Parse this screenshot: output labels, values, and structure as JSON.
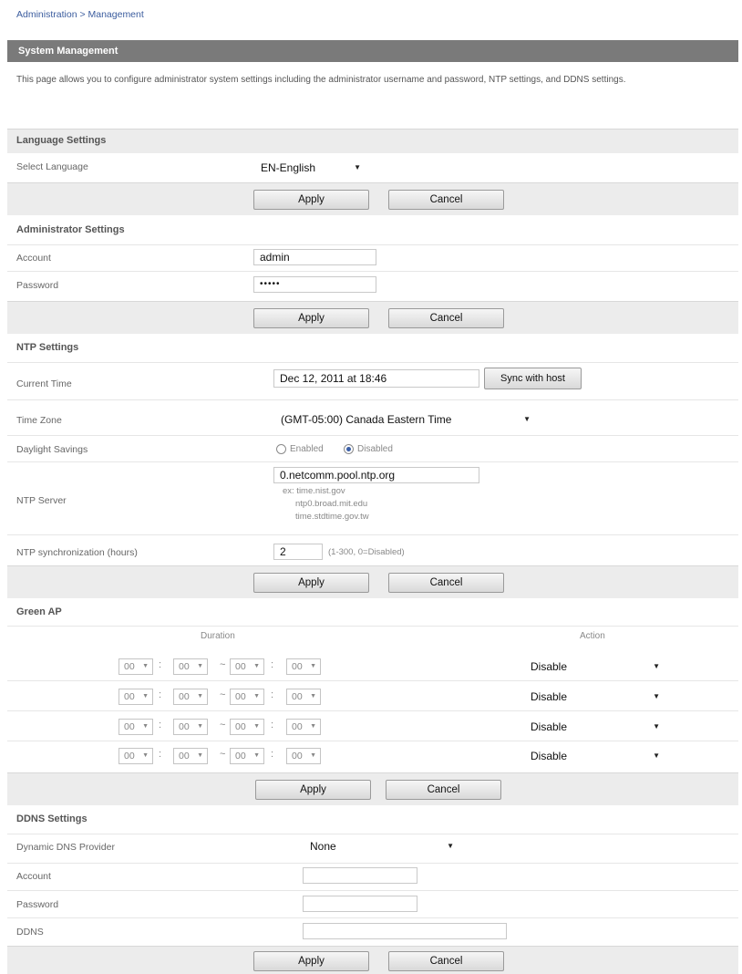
{
  "breadcrumb": "Administration > Management",
  "title": "System Management",
  "description": "This page allows you to configure administrator system settings including the administrator username and password, NTP settings, and DDNS settings.",
  "buttons": {
    "apply": "Apply",
    "cancel": "Cancel"
  },
  "language": {
    "heading": "Language Settings",
    "select_label": "Select Language",
    "selected": "EN-English"
  },
  "admin": {
    "heading": "Administrator Settings",
    "account_label": "Account",
    "account_value": "admin",
    "password_label": "Password",
    "password_value": "•••••"
  },
  "ntp": {
    "heading": "NTP Settings",
    "current_time_label": "Current Time",
    "current_time_value": "Dec 12, 2011 at 18:46",
    "sync_button": "Sync with host",
    "timezone_label": "Time Zone",
    "timezone_value": "(GMT-05:00) Canada Eastern Time",
    "daylight_label": "Daylight Savings",
    "enabled_label": "Enabled",
    "disabled_label": "Disabled",
    "daylight_selected": "Disabled",
    "server_label": "NTP Server",
    "server_value": "0.netcomm.pool.ntp.org",
    "examples": [
      "ex: time.nist.gov",
      "ntp0.broad.mit.edu",
      "time.stdtime.gov.tw"
    ],
    "sync_label": "NTP synchronization (hours)",
    "sync_value": "2",
    "sync_hint": "(1-300, 0=Disabled)"
  },
  "green_ap": {
    "heading": "Green AP",
    "duration_header": "Duration",
    "action_header": "Action",
    "rows": [
      {
        "h1": "00",
        "m1": "00",
        "h2": "00",
        "m2": "00",
        "action": "Disable"
      },
      {
        "h1": "00",
        "m1": "00",
        "h2": "00",
        "m2": "00",
        "action": "Disable"
      },
      {
        "h1": "00",
        "m1": "00",
        "h2": "00",
        "m2": "00",
        "action": "Disable"
      },
      {
        "h1": "00",
        "m1": "00",
        "h2": "00",
        "m2": "00",
        "action": "Disable"
      }
    ]
  },
  "ddns": {
    "heading": "DDNS Settings",
    "provider_label": "Dynamic DNS Provider",
    "provider_value": "None",
    "account_label": "Account",
    "account_value": "",
    "password_label": "Password",
    "password_value": "",
    "ddns_label": "DDNS",
    "ddns_value": ""
  }
}
